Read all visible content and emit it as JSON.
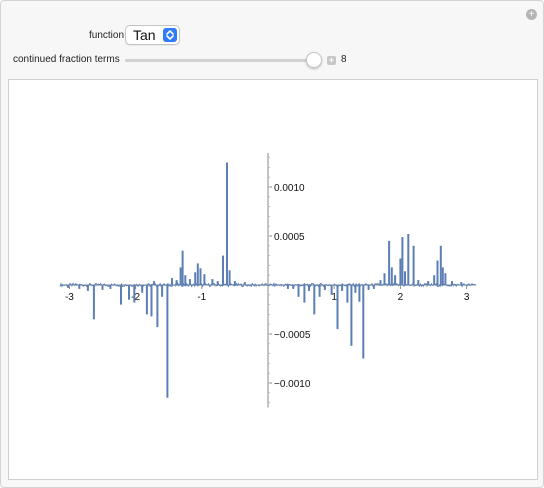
{
  "controls": {
    "function_label": "function",
    "function_value": "Tan",
    "cf_label": "continued fraction terms",
    "cf_value": "8",
    "cf_slider_fraction": 0.95
  },
  "colors": {
    "series": "#5b7fb4",
    "accent": "#2f7cf6"
  },
  "chart_data": {
    "type": "line",
    "title": "",
    "xlabel": "",
    "ylabel": "",
    "xlim": [
      -3.14159,
      3.14159
    ],
    "ylim": [
      -0.00125,
      0.00135
    ],
    "x_ticks": [
      -3,
      -2,
      -1,
      1,
      2,
      3
    ],
    "x_tick_labels": [
      "-3",
      "-2",
      "-1",
      "1",
      "2",
      "3"
    ],
    "y_ticks": [
      -0.001,
      -0.0005,
      0.0005,
      0.001
    ],
    "y_tick_labels": [
      "−0.0010",
      "−0.0005",
      "0.0005",
      "0.0010"
    ],
    "series": [
      {
        "spikes": [
          [
            -3.02,
            -3e-05
          ],
          [
            -2.85,
            -4e-05
          ],
          [
            -2.72,
            -6e-05
          ],
          [
            -2.63,
            -0.00035
          ],
          [
            -2.5,
            -5e-05
          ],
          [
            -2.38,
            -4e-05
          ],
          [
            -2.22,
            -0.0002
          ],
          [
            -2.1,
            -0.00015
          ],
          [
            -2.02,
            -0.00018
          ],
          [
            -1.9,
            -8e-05
          ],
          [
            -1.83,
            -0.0003
          ],
          [
            -1.76,
            -0.00032
          ],
          [
            -1.72,
            4e-05
          ],
          [
            -1.67,
            -0.00043
          ],
          [
            -1.6,
            -0.00012
          ],
          [
            -1.52,
            -0.00115
          ],
          [
            -1.45,
            7e-05
          ],
          [
            -1.38,
            5e-05
          ],
          [
            -1.32,
            0.00018
          ],
          [
            -1.29,
            0.00035
          ],
          [
            -1.25,
            0.0001
          ],
          [
            -1.18,
            6e-05
          ],
          [
            -1.1,
            0.00013
          ],
          [
            -1.06,
            0.00022
          ],
          [
            -1.02,
            0.00017
          ],
          [
            -0.96,
            0.00011
          ],
          [
            -0.84,
            6e-05
          ],
          [
            -0.76,
            4e-05
          ],
          [
            -0.68,
            0.0003
          ],
          [
            -0.62,
            0.00125
          ],
          [
            -0.58,
            0.00015
          ],
          [
            -0.5,
            4e-05
          ],
          [
            -0.35,
            3e-05
          ],
          [
            0.3,
            -4e-05
          ],
          [
            0.38,
            -4e-05
          ],
          [
            0.46,
            -0.00012
          ],
          [
            0.55,
            -0.00018
          ],
          [
            0.62,
            -6e-05
          ],
          [
            0.7,
            -0.0003
          ],
          [
            0.78,
            -0.00012
          ],
          [
            0.86,
            -5e-05
          ],
          [
            0.96,
            -0.0001
          ],
          [
            1.05,
            -0.00045
          ],
          [
            1.12,
            -6e-05
          ],
          [
            1.2,
            -0.00018
          ],
          [
            1.26,
            -0.00062
          ],
          [
            1.32,
            -8e-05
          ],
          [
            1.38,
            -0.00017
          ],
          [
            1.44,
            -0.00075
          ],
          [
            1.52,
            -5e-05
          ],
          [
            1.6,
            -4e-05
          ],
          [
            1.7,
            5e-05
          ],
          [
            1.76,
            0.00012
          ],
          [
            1.83,
            0.00045
          ],
          [
            1.87,
            0.00018
          ],
          [
            1.92,
            0.0001
          ],
          [
            2.0,
            0.00027
          ],
          [
            2.03,
            0.00049
          ],
          [
            2.07,
            0.00014
          ],
          [
            2.12,
            0.00052
          ],
          [
            2.2,
            0.0004
          ],
          [
            2.27,
            5e-05
          ],
          [
            2.42,
            4e-05
          ],
          [
            2.51,
            0.0001
          ],
          [
            2.56,
            0.00025
          ],
          [
            2.61,
            0.0004
          ],
          [
            2.64,
            0.00018
          ],
          [
            2.68,
            0.00012
          ],
          [
            2.78,
            4e-05
          ],
          [
            2.92,
            3e-05
          ]
        ]
      }
    ]
  }
}
